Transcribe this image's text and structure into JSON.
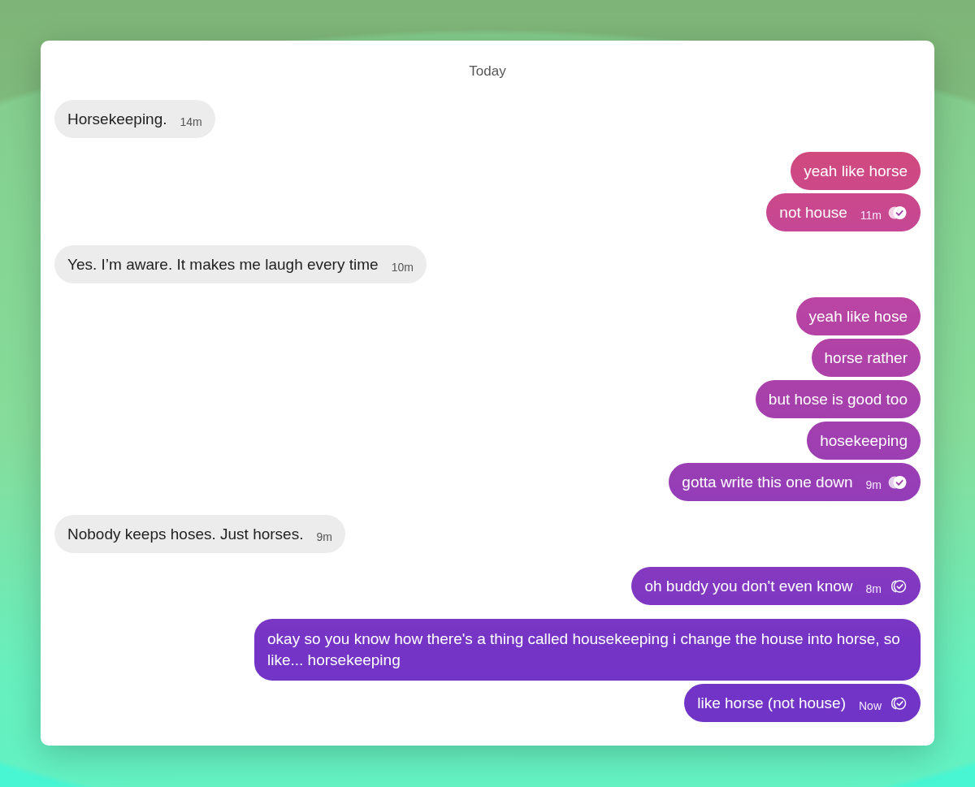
{
  "day_label": "Today",
  "groups": [
    {
      "kind": "incoming",
      "messages": [
        {
          "text": "Horsekeeping.",
          "time": "14m"
        }
      ]
    },
    {
      "kind": "outgoing",
      "messages": [
        {
          "text": "yeah like horse"
        },
        {
          "text": "not house",
          "time": "11m",
          "read": true
        }
      ]
    },
    {
      "kind": "incoming",
      "messages": [
        {
          "text": "Yes. I’m aware. It makes me laugh every time",
          "time": "10m"
        }
      ]
    },
    {
      "kind": "outgoing",
      "messages": [
        {
          "text": "yeah like hose"
        },
        {
          "text": "horse rather"
        },
        {
          "text": "but hose is good too"
        },
        {
          "text": "hosekeeping"
        },
        {
          "text": "gotta write this one down",
          "time": "9m",
          "read": true
        }
      ]
    },
    {
      "kind": "incoming",
      "messages": [
        {
          "text": "Nobody keeps hoses. Just horses.",
          "time": "9m"
        }
      ]
    },
    {
      "kind": "outgoing",
      "messages": [
        {
          "text": "oh buddy you don't even know",
          "time": "8m",
          "read": false
        }
      ]
    },
    {
      "kind": "outgoing",
      "messages": [
        {
          "text": "okay so you know how there's a thing called housekeeping i change the house into horse, so like... horsekeeping"
        },
        {
          "text": "like horse (not house)",
          "time": "Now",
          "read": false
        }
      ]
    }
  ]
}
